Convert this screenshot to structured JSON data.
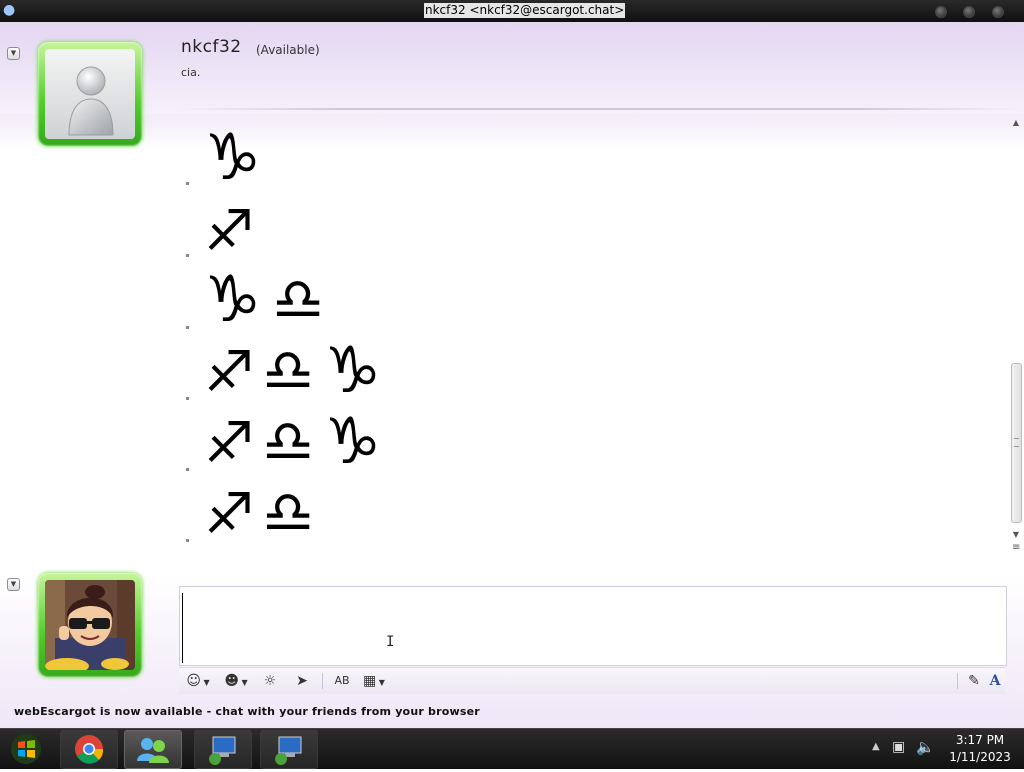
{
  "window": {
    "title": "nkcf32 <nkcf32@escargot.chat>"
  },
  "contact": {
    "name": "nkcf32",
    "status": "(Available)",
    "personal_message": "cia."
  },
  "messages": [
    {
      "symbols": [
        "♑"
      ]
    },
    {
      "symbols": [
        "♐"
      ]
    },
    {
      "symbols": [
        "♑",
        "♎"
      ]
    },
    {
      "symbols": [
        "♐",
        "♎",
        "♑"
      ]
    },
    {
      "symbols": [
        "♐",
        "♎",
        "♑"
      ]
    },
    {
      "symbols": [
        "♐",
        "♎"
      ]
    }
  ],
  "status_bar": {
    "text": "webEscargot is now available - chat with your friends from your browser"
  },
  "toolbar": {
    "emoticon_icon": "smiley-icon",
    "wink_icon": "wink-icon",
    "voice_clip_icon": "voice-clip-icon",
    "nudge_icon": "nudge-icon",
    "font_icon": "font-icon",
    "background_icon": "background-icon",
    "handwriting_icon": "handwriting-icon",
    "text_format_label": "A"
  },
  "taskbar": {
    "time": "3:17 PM",
    "date": "1/11/2023"
  },
  "colors": {
    "avatar_border": "#4fcc2a",
    "header_tint": "#e3d6f1",
    "taskbar": "#1a1a1a"
  }
}
